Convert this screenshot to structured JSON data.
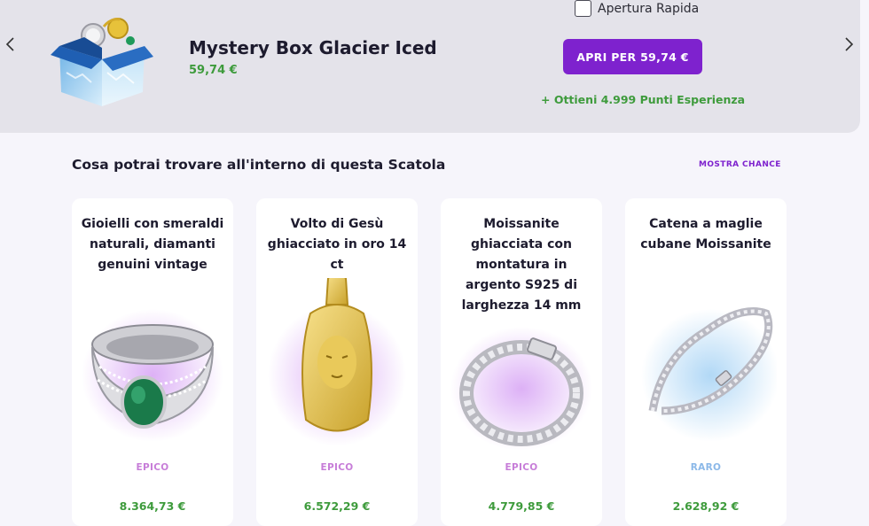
{
  "hero": {
    "title": "Mystery Box Glacier Iced",
    "price": "59,74 €",
    "quick_open_label": "Apertura Rapida",
    "open_button_label": "APRI PER 59,74 €",
    "xp_text": "+ Ottieni 4.999 Punti Esperienza"
  },
  "section": {
    "title": "Cosa potrai trovare all'interno di questa Scatola",
    "show_chance_label": "MOSTRA CHANCE"
  },
  "items": [
    {
      "name": "Gioielli con smeraldi naturali, diamanti genuini vintage",
      "rarity": "EPICO",
      "price": "8.364,73 €",
      "rarity_color": "#c77dd8",
      "glow_color": "#d9a8f5"
    },
    {
      "name": "Volto di Gesù ghiacciato in oro 14 ct",
      "rarity": "EPICO",
      "price": "6.572,29 €",
      "rarity_color": "#c77dd8",
      "glow_color": "#d9a8f5"
    },
    {
      "name": "Moissanite ghiacciata con montatura in argento S925 di larghezza 14 mm",
      "rarity": "EPICO",
      "price": "4.779,85 €",
      "rarity_color": "#c77dd8",
      "glow_color": "#d9a8f5"
    },
    {
      "name": "Catena a maglie cubane Moissanite",
      "rarity": "RARO",
      "price": "2.628,92 €",
      "rarity_color": "#8bb8e8",
      "glow_color": "#a9d4f5"
    }
  ],
  "icons": {
    "prev": "chevron-left-icon",
    "next": "chevron-right-icon"
  }
}
